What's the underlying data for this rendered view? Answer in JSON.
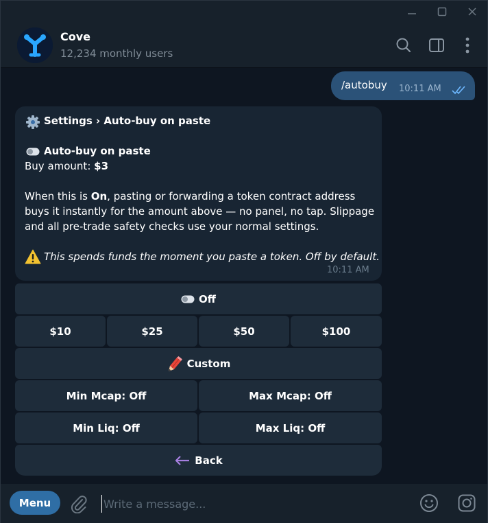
{
  "chat": {
    "title": "Cove",
    "subtitle": "12,234 monthly users"
  },
  "outgoing": {
    "text": "/autobuy",
    "time": "10:11 AM"
  },
  "incoming": {
    "title": "Settings › Auto-buy on paste",
    "toggle_label": "Auto-buy on paste",
    "amount_label": "Buy amount: ",
    "amount_value": "$3",
    "para_1a": "When this is ",
    "para_1b": "On",
    "para_1c": ", pasting or forwarding a token contract address",
    "para_2": "buys it instantly for the amount above — no panel, no tap. Slippage",
    "para_3": "and all pre-trade safety checks use your normal settings.",
    "warning": "This spends funds the moment you paste a token. Off by default.",
    "time": "10:11 AM"
  },
  "keyboard": {
    "toggle": "Off",
    "amount_10": "$10",
    "amount_25": "$25",
    "amount_50": "$50",
    "amount_100": "$100",
    "custom": "Custom",
    "min_mcap": "Min Mcap: Off",
    "max_mcap": "Max Mcap: Off",
    "min_liq": "Min Liq: Off",
    "max_liq": "Max Liq: Off",
    "back": "Back"
  },
  "composer": {
    "menu_label": "Menu",
    "placeholder": "Write a message..."
  },
  "colors": {
    "background": "#0e1621",
    "panel": "#17212b",
    "outgoing_bubble": "#2b5278",
    "incoming_bubble": "#182533",
    "keyboard_button": "#1e2c3a",
    "accent": "#2f6ea5"
  },
  "icons": {
    "window": [
      "minimize-icon",
      "maximize-icon",
      "close-icon"
    ],
    "header": [
      "search-icon",
      "sidebar-panel-icon",
      "more-vertical-icon"
    ],
    "message": [
      "gear-icon",
      "toggle-icon",
      "warning-icon",
      "pencil-icon",
      "back-arrow-icon",
      "double-check-icon"
    ],
    "composer": [
      "paperclip-icon",
      "emoji-icon",
      "sticker-icon"
    ]
  }
}
